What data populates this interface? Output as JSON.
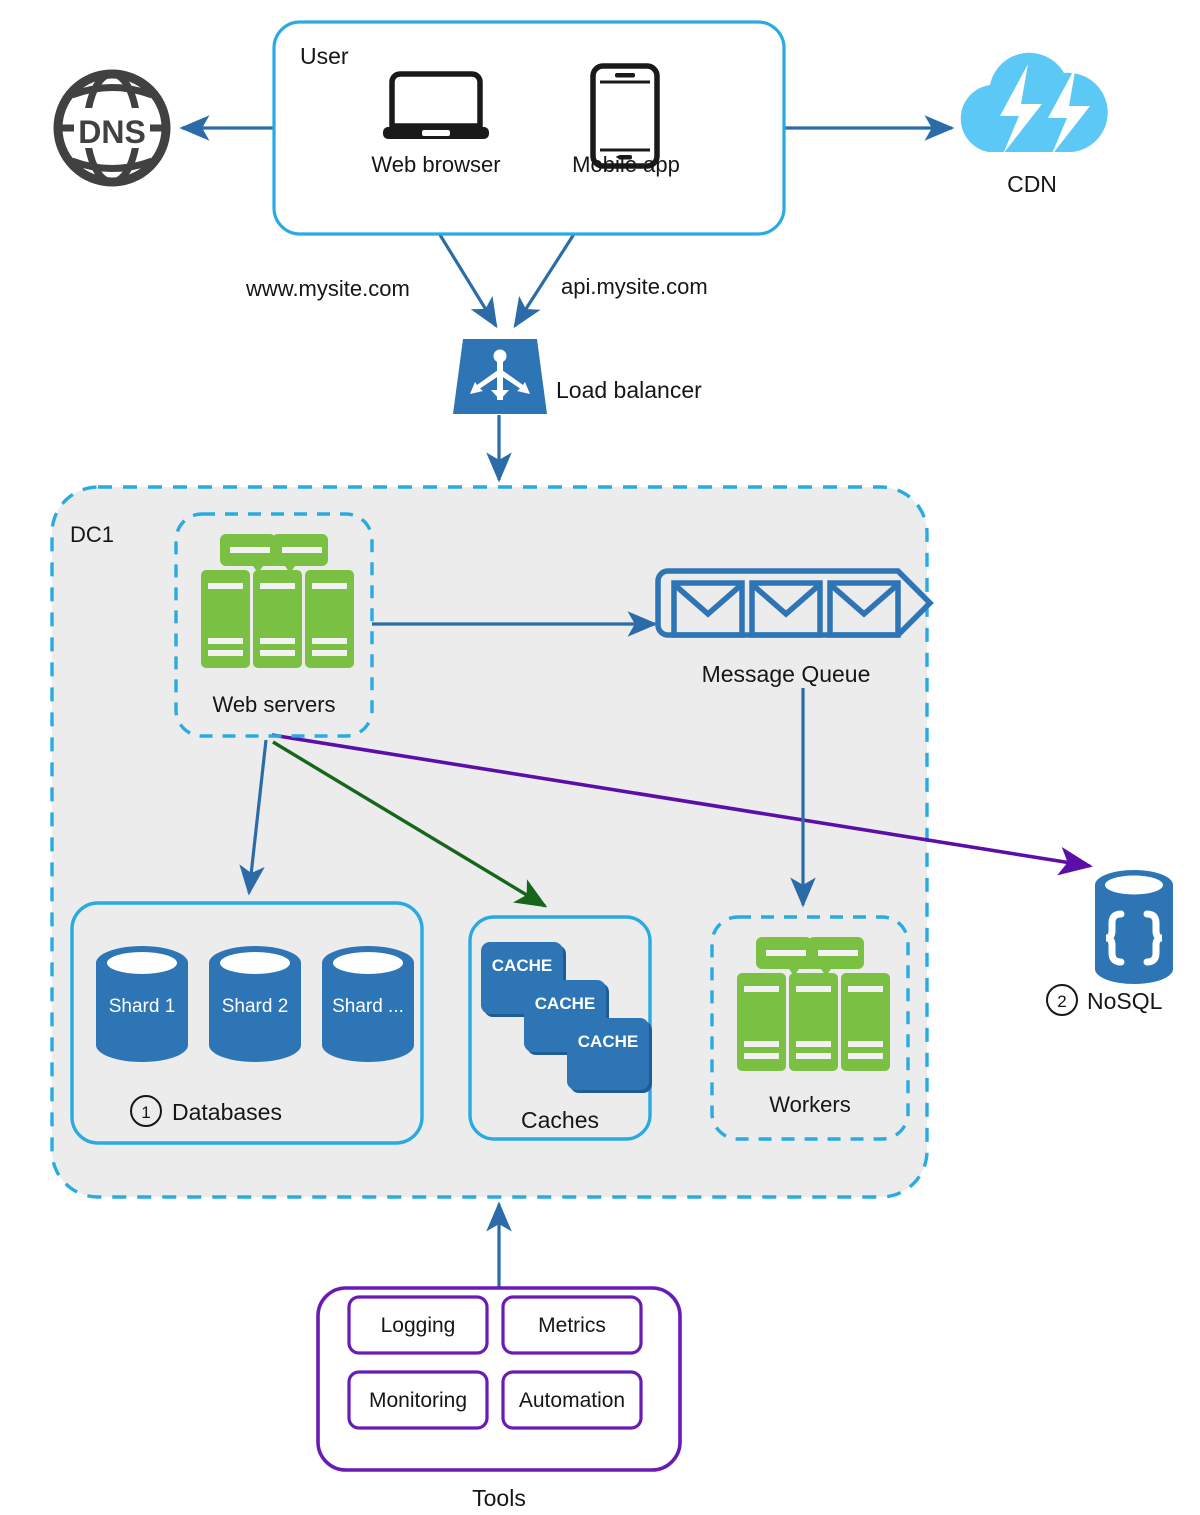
{
  "diagram": {
    "title_hidden": "",
    "colors": {
      "cyan": "#29ABE2",
      "blue": "#2E75B6",
      "blue_dark": "#2B6CA8",
      "cdn_cloud": "#5BC8F5",
      "green_server": "#7AC143",
      "green_arrow": "#16661B",
      "purple": "#5B0FA8",
      "tools_purple": "#6A1BB5",
      "dns_gray": "#414141",
      "dc_fill": "#ECECEC",
      "db_blue": "#2E75B6",
      "text": "#161616"
    },
    "nodes": {
      "dns": {
        "label": "DNS",
        "icon": "globe-icon"
      },
      "user_group": {
        "label": "User"
      },
      "web_browser": {
        "label": "Web browser",
        "icon": "laptop-icon"
      },
      "mobile_app": {
        "label": "Mobile app",
        "icon": "smartphone-icon"
      },
      "cdn": {
        "label": "CDN",
        "icon": "cloud-lightning-icon"
      },
      "load_balancer": {
        "label": "Load balancer",
        "icon": "load-balancer-icon"
      },
      "datacenter": {
        "label": "DC1"
      },
      "web_servers": {
        "label": "Web servers",
        "icon": "server-rack-icon"
      },
      "message_queue": {
        "label": "Message Queue",
        "icon": "envelope-icon"
      },
      "databases": {
        "label": "Databases",
        "badge": "1"
      },
      "caches": {
        "label": "Caches"
      },
      "workers": {
        "label": "Workers",
        "icon": "server-rack-icon"
      },
      "nosql": {
        "label": "NoSQL",
        "badge": "2",
        "icon": "database-braces-icon"
      },
      "tools": {
        "label": "Tools"
      }
    },
    "shards": [
      {
        "label": "Shard 1"
      },
      {
        "label": "Shard 2"
      },
      {
        "label": "Shard ..."
      }
    ],
    "caches": [
      {
        "label": "CACHE"
      },
      {
        "label": "CACHE"
      },
      {
        "label": "CACHE"
      }
    ],
    "queue_messages": [
      {
        "icon": "envelope-icon"
      },
      {
        "icon": "envelope-icon"
      },
      {
        "icon": "envelope-icon"
      }
    ],
    "tools_items": [
      {
        "label": "Logging"
      },
      {
        "label": "Metrics"
      },
      {
        "label": "Monitoring"
      },
      {
        "label": "Automation"
      }
    ],
    "edge_labels": {
      "www": "www.mysite.com",
      "api": "api.mysite.com"
    }
  }
}
